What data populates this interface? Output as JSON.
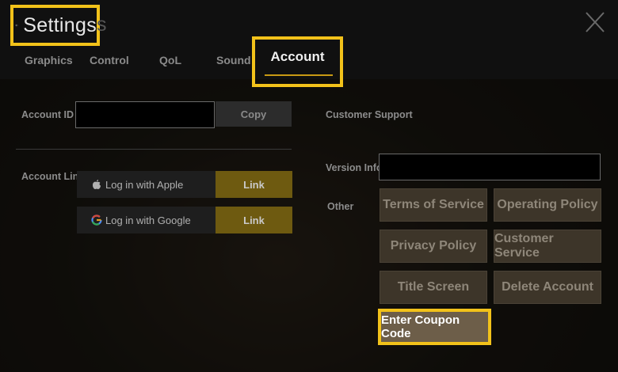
{
  "header": {
    "title": "Settings",
    "title_overflow": "s"
  },
  "tabs": [
    {
      "label": "Graphics"
    },
    {
      "label": "Control"
    },
    {
      "label": "QoL"
    },
    {
      "label": "Sound"
    },
    {
      "label": "Account",
      "active": true
    }
  ],
  "account": {
    "id_label": "Account ID",
    "id_value": "",
    "copy_label": "Copy",
    "link_section_label": "Account Link",
    "apple_label": "Log in with Apple",
    "google_label": "Log in with Google",
    "link_label": "Link"
  },
  "support": {
    "title": "Customer Support",
    "version_label": "Version Info",
    "version_value": "",
    "other_label": "Other",
    "buttons": {
      "terms": "Terms of Service",
      "operating": "Operating Policy",
      "privacy": "Privacy Policy",
      "customer_service": "Customer Service",
      "title_screen": "Title Screen",
      "delete_account": "Delete Account",
      "coupon": "Enter Coupon Code"
    }
  },
  "colors": {
    "highlight": "#f2c21a",
    "link_button": "#6e5a10",
    "option_button": "#3d3529"
  },
  "icons": {
    "back": "arrow-left-icon",
    "close": "close-icon",
    "apple": "apple-icon",
    "google": "google-icon"
  }
}
